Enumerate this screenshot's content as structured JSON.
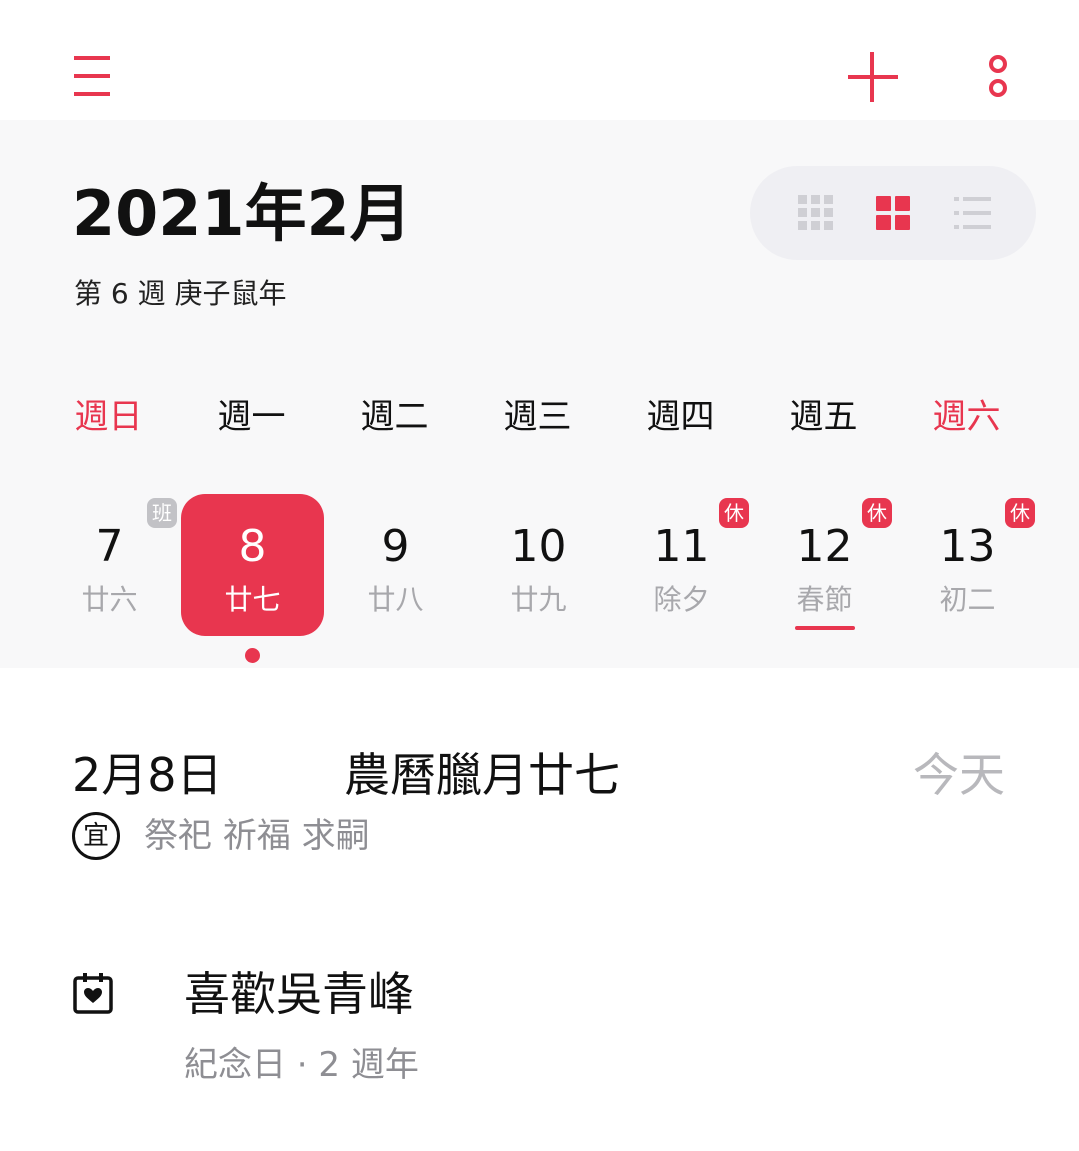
{
  "colors": {
    "accent": "#e8364f",
    "panel_bg": "#f8f8f9",
    "muted_text": "#a8a8ac",
    "badge_gray": "#c2c2c6"
  },
  "toolbar": {
    "menu_icon": "hamburger-menu-icon",
    "add_icon": "plus-icon",
    "more_icon": "more-vertical-icon"
  },
  "header": {
    "title": "2021年2月",
    "subtitle": "第 6 週 庚子鼠年"
  },
  "view_switch": {
    "options": [
      {
        "name": "month-grid-view",
        "icon": "grid-9-icon",
        "selected": false
      },
      {
        "name": "week-view",
        "icon": "grid-4-icon",
        "selected": true
      },
      {
        "name": "list-view",
        "icon": "list-icon",
        "selected": false
      }
    ]
  },
  "weekdays": [
    "週日",
    "週一",
    "週二",
    "週三",
    "週四",
    "週五",
    "週六"
  ],
  "days": [
    {
      "num": "7",
      "lunar": "廿六",
      "badge": "班",
      "badge_type": "work",
      "selected": false
    },
    {
      "num": "8",
      "lunar": "廿七",
      "badge": "",
      "badge_type": "",
      "selected": true,
      "has_event": true
    },
    {
      "num": "9",
      "lunar": "廿八",
      "badge": "",
      "badge_type": "",
      "selected": false
    },
    {
      "num": "10",
      "lunar": "廿九",
      "badge": "",
      "badge_type": "",
      "selected": false
    },
    {
      "num": "11",
      "lunar": "除夕",
      "badge": "休",
      "badge_type": "holiday",
      "selected": false
    },
    {
      "num": "12",
      "lunar": "春節",
      "badge": "休",
      "badge_type": "holiday",
      "selected": false,
      "festival_underline": true
    },
    {
      "num": "13",
      "lunar": "初二",
      "badge": "休",
      "badge_type": "holiday",
      "selected": false
    }
  ],
  "selected_date": {
    "date": "2月8日",
    "lunar": "農曆臘月廿七",
    "today_label": "今天",
    "yi_label": "宜",
    "yi_items": "祭祀 祈福 求嗣"
  },
  "event": {
    "icon": "calendar-heart-icon",
    "title": "喜歡吳青峰",
    "subtitle": "紀念日 · 2 週年"
  }
}
